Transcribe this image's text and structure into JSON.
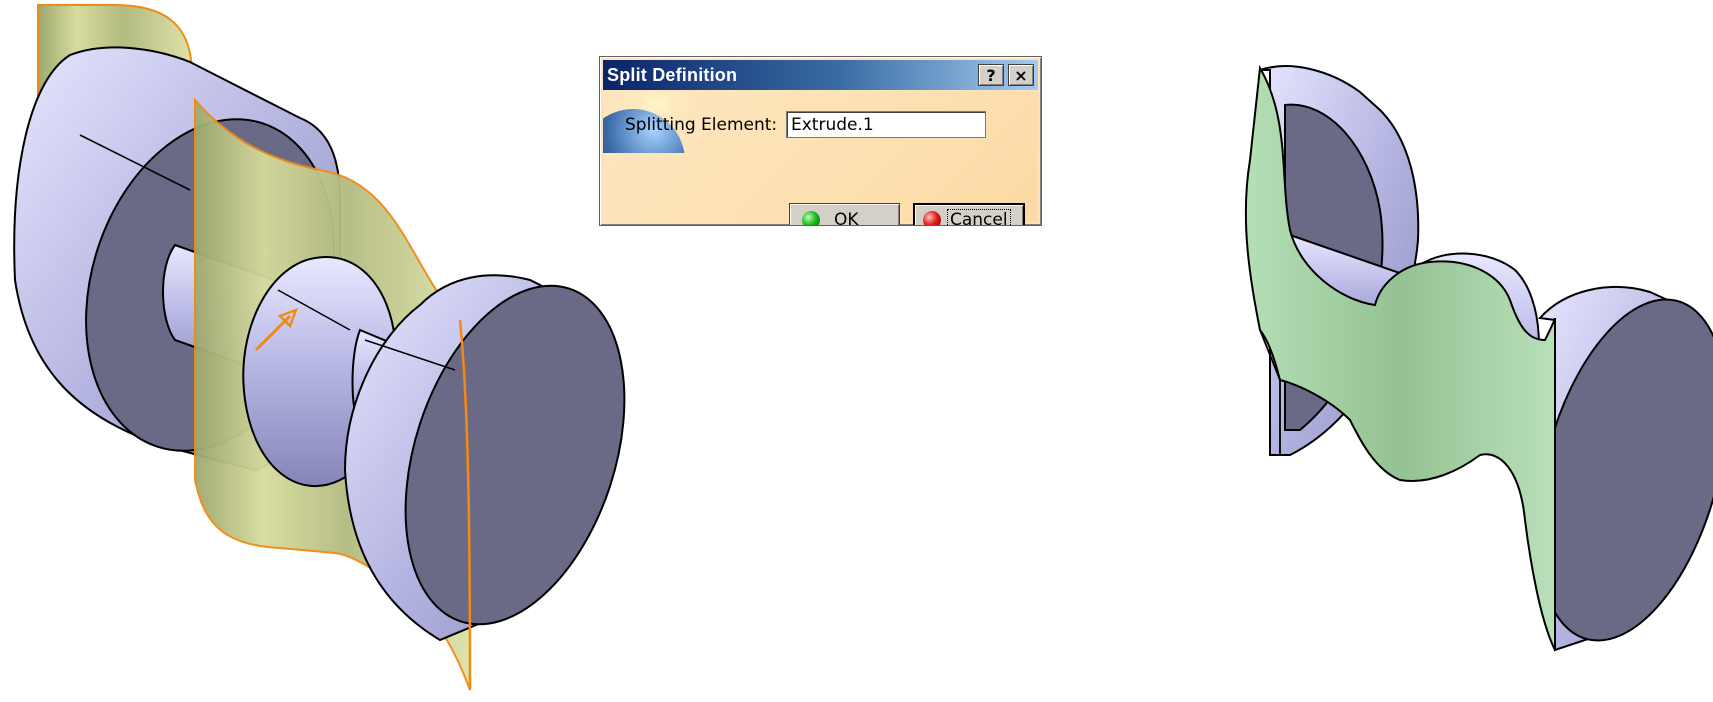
{
  "dialog": {
    "title": "Split Definition",
    "help_button": "?",
    "close_button": "×",
    "splitting_element_label": "Splitting Element:",
    "splitting_element_value": "Extrude.1",
    "ok_label": "OK",
    "cancel_label": "Cancel"
  },
  "icons": {
    "help": "question-mark-icon",
    "close": "close-icon",
    "ok": "green-led-icon",
    "cancel": "red-led-icon",
    "decoration": "globe-icon"
  },
  "colors": {
    "part_face_light": "#c4c4ee",
    "part_face_dark": "#6b6a86",
    "splitting_surface": "#c6cc8e",
    "surface_edge": "#f08a12",
    "cut_face": "#9fcc9f",
    "title_bar": "#0a246a",
    "dialog_background": "#fde3b8"
  }
}
